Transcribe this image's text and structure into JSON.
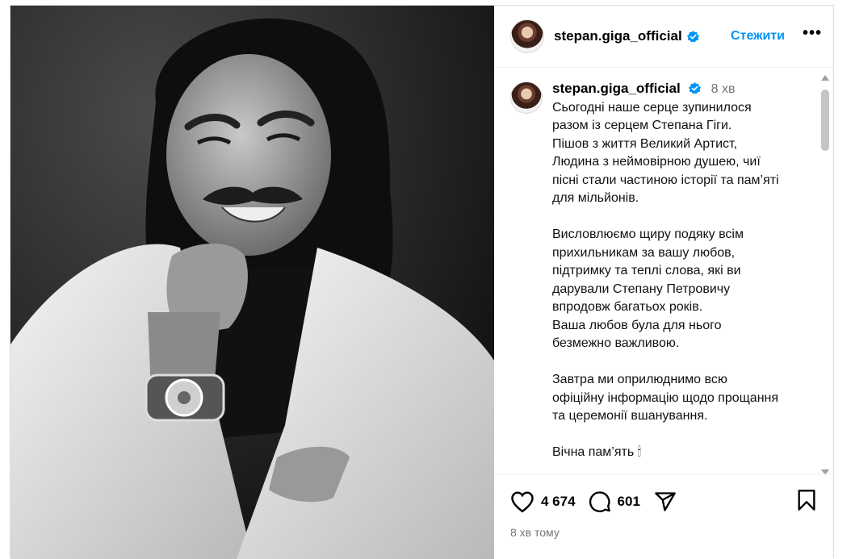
{
  "post": {
    "username": "stepan.giga_official",
    "follow_label": "Стежити",
    "more_label": "•••",
    "caption_time": "8 хв",
    "caption_paragraphs": [
      [
        "Сьогодні наше серце зупинилося",
        "разом із серцем Степана Гіги.",
        "Пішов з життя Великий Артист,",
        "Людина з неймовірною душею, чиї",
        "пісні стали частиною історії та пам’яті",
        "для мільйонів."
      ],
      [
        "Висловлюємо щиру подяку всім",
        "прихильникам за вашу любов,",
        "підтримку та теплі слова, які ви",
        "дарували Степану Петровичу",
        "впродовж багатьох років.",
        "Ваша любов була для нього",
        "безмежно важливою."
      ],
      [
        "Завтра ми оприлюднимо всю",
        "офіційну інформацію щодо прощання",
        "та церемонії вшанування."
      ],
      [
        "Вічна пам’ять 🕯"
      ]
    ],
    "likes": "4 674",
    "comments_count": "601",
    "posted_ago": "8 хв тому"
  },
  "icons": {
    "like": "heart-icon",
    "comment": "comment-icon",
    "share": "share-icon",
    "save": "bookmark-icon",
    "verified": "verified-badge-icon"
  },
  "colors": {
    "accent": "#0095f6",
    "muted": "#737373",
    "photo_bg": "#1a1a1a"
  }
}
